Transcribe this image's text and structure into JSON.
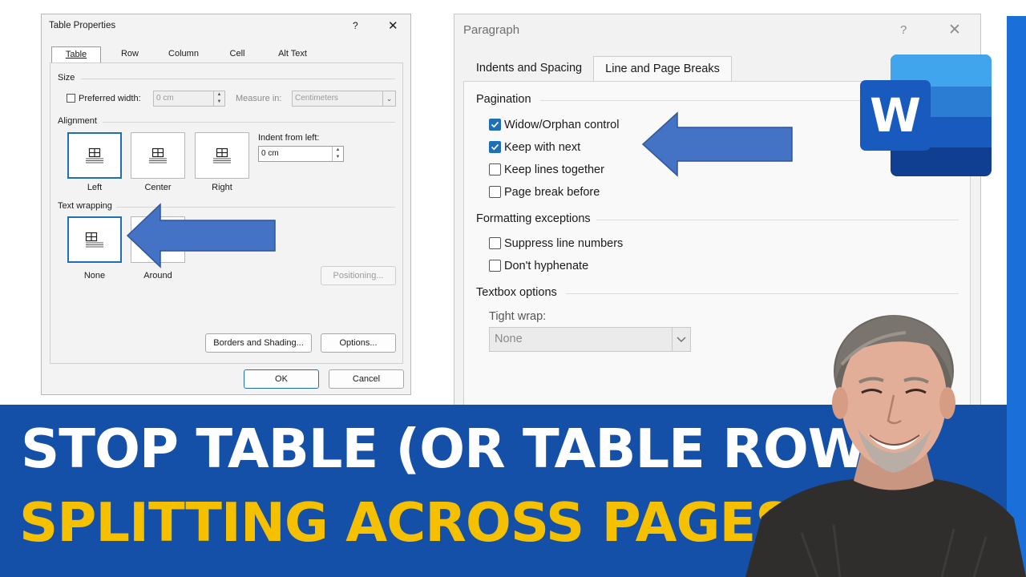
{
  "table_properties": {
    "title": "Table Properties",
    "help": "?",
    "close": "✕",
    "tabs": [
      "Table",
      "Row",
      "Column",
      "Cell",
      "Alt Text"
    ],
    "active_tab": "Table",
    "size": {
      "section": "Size",
      "preferred_width_label": "Preferred width:",
      "preferred_width_checked": false,
      "width_value": "0 cm",
      "measure_label": "Measure in:",
      "measure_value": "Centimeters"
    },
    "alignment": {
      "section": "Alignment",
      "options": [
        "Left",
        "Center",
        "Right"
      ],
      "selected": "Left",
      "indent_label": "Indent from left:",
      "indent_value": "0 cm"
    },
    "text_wrapping": {
      "section": "Text wrapping",
      "options": [
        "None",
        "Around"
      ],
      "selected": "None",
      "positioning_button": "Positioning..."
    },
    "borders_button": "Borders and Shading...",
    "options_button": "Options...",
    "ok_button": "OK",
    "cancel_button": "Cancel"
  },
  "paragraph": {
    "title": "Paragraph",
    "help": "?",
    "close": "✕",
    "tabs": [
      "Indents and Spacing",
      "Line and Page Breaks"
    ],
    "active_tab": "Line and Page Breaks",
    "pagination": {
      "section": "Pagination",
      "items": [
        {
          "label": "Widow/Orphan control",
          "checked": true
        },
        {
          "label": "Keep with next",
          "checked": true
        },
        {
          "label": "Keep lines together",
          "checked": false
        },
        {
          "label": "Page break before",
          "checked": false
        }
      ]
    },
    "formatting_exceptions": {
      "section": "Formatting exceptions",
      "items": [
        {
          "label": "Suppress line numbers",
          "checked": false
        },
        {
          "label": "Don't hyphenate",
          "checked": false
        }
      ]
    },
    "textbox_options": {
      "section": "Textbox options",
      "tight_wrap_label": "Tight wrap:",
      "tight_wrap_value": "None"
    }
  },
  "word_logo": {
    "letter": "W"
  },
  "banner": {
    "line1": "STOP TABLE (OR TABLE ROW)",
    "line2": "SPLITTING ACROSS PAGES"
  },
  "colors": {
    "banner_bg": "#1450a8",
    "line1": "#ffffff",
    "line2": "#f5c000",
    "arrow": "#4472c4",
    "accent": "#1f6fb4"
  }
}
